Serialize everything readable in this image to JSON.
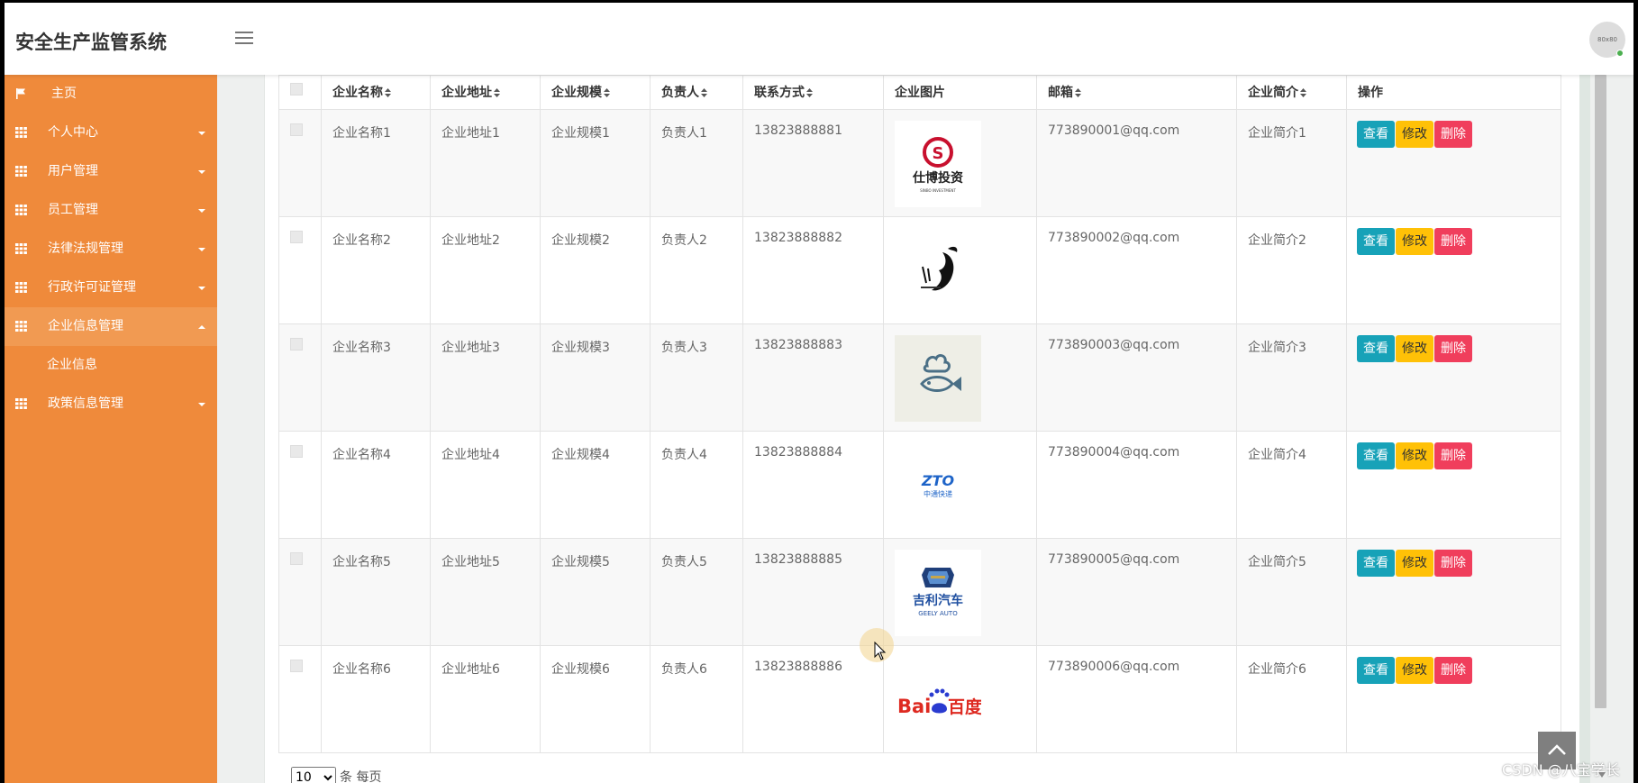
{
  "header": {
    "title": "安全生产监管系统",
    "avatar_text": "80x80"
  },
  "sidebar": {
    "items": [
      {
        "label": "主页",
        "icon": "flag-icon",
        "caret": false
      },
      {
        "label": "个人中心",
        "icon": "grid-icon",
        "caret": "down"
      },
      {
        "label": "用户管理",
        "icon": "grid-icon",
        "caret": "down"
      },
      {
        "label": "员工管理",
        "icon": "grid-icon",
        "caret": "down"
      },
      {
        "label": "法律法规管理",
        "icon": "grid-icon",
        "caret": "down"
      },
      {
        "label": "行政许可证管理",
        "icon": "grid-icon",
        "caret": "down"
      },
      {
        "label": "企业信息管理",
        "icon": "grid-icon",
        "caret": "up",
        "active": true
      },
      {
        "label": "政策信息管理",
        "icon": "grid-icon",
        "caret": "down"
      }
    ],
    "sub_items": [
      "企业信息"
    ]
  },
  "table": {
    "columns": [
      "企业名称",
      "企业地址",
      "企业规模",
      "负责人",
      "联系方式",
      "企业图片",
      "邮箱",
      "企业简介",
      "操作"
    ],
    "rows": [
      {
        "name": "企业名称1",
        "address": "企业地址1",
        "scale": "企业规模1",
        "manager": "负责人1",
        "phone": "13823888881",
        "logo": "仕博投资",
        "logo_sub": "SINBO INVESTMENT",
        "email": "773890001@qq.com",
        "intro": "企业简介1"
      },
      {
        "name": "企业名称2",
        "address": "企业地址2",
        "scale": "企业规模2",
        "manager": "负责人2",
        "phone": "13823888882",
        "logo": "",
        "logo_sub": "",
        "email": "773890002@qq.com",
        "intro": "企业简介2"
      },
      {
        "name": "企业名称3",
        "address": "企业地址3",
        "scale": "企业规模3",
        "manager": "负责人3",
        "phone": "13823888883",
        "logo": "fish",
        "logo_sub": "",
        "email": "773890003@qq.com",
        "intro": "企业简介3"
      },
      {
        "name": "企业名称4",
        "address": "企业地址4",
        "scale": "企业规模4",
        "manager": "负责人4",
        "phone": "13823888884",
        "logo": "ZTO",
        "logo_sub": "中通快递",
        "email": "773890004@qq.com",
        "intro": "企业简介4"
      },
      {
        "name": "企业名称5",
        "address": "企业地址5",
        "scale": "企业规模5",
        "manager": "负责人5",
        "phone": "13823888885",
        "logo": "吉利汽车",
        "logo_sub": "GEELY AUTO",
        "email": "773890005@qq.com",
        "intro": "企业简介5"
      },
      {
        "name": "企业名称6",
        "address": "企业地址6",
        "scale": "企业规模6",
        "manager": "负责人6",
        "phone": "13823888886",
        "logo": "Bai",
        "logo_sub": "百度",
        "email": "773890006@qq.com",
        "intro": "企业简介6"
      }
    ],
    "actions": {
      "view": "查看",
      "edit": "修改",
      "delete": "删除"
    }
  },
  "pager": {
    "page_size": "10",
    "suffix": "条 每页"
  },
  "watermark": "CSDN @八宝学长",
  "colors": {
    "sidebar": "#ef8a3b",
    "btn_view": "#17a2b8",
    "btn_edit": "#ffc107",
    "btn_delete": "#f03e5c"
  }
}
